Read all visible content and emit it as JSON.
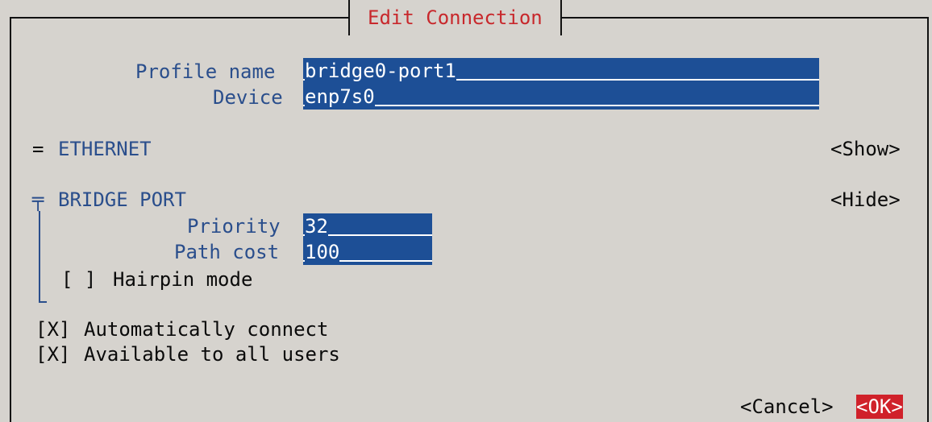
{
  "dialog": {
    "title": "Edit Connection"
  },
  "profile": {
    "name_label": "Profile name",
    "name_value": "bridge0-port1",
    "device_label": "Device",
    "device_value": "enp7s0"
  },
  "ethernet": {
    "marker": "=",
    "label": "ETHERNET",
    "toggle": "<Show>"
  },
  "bridge_port": {
    "marker": "╤",
    "label": "BRIDGE PORT",
    "toggle": "<Hide>",
    "priority_label": "Priority",
    "priority_value": "32",
    "path_cost_label": "Path cost",
    "path_cost_value": "100",
    "hairpin_checkbox": "[ ]",
    "hairpin_label": "Hairpin mode"
  },
  "options": {
    "auto_connect_checkbox": "[X]",
    "auto_connect_label": "Automatically connect",
    "all_users_checkbox": "[X]",
    "all_users_label": "Available to all users"
  },
  "buttons": {
    "cancel": "<Cancel>",
    "ok": "<OK>"
  },
  "colors": {
    "background": "#d6d3ce",
    "field_bg": "#1d4f96",
    "label_blue": "#2a4e8c",
    "title_red": "#c8282c",
    "ok_bg": "#d0212a"
  }
}
